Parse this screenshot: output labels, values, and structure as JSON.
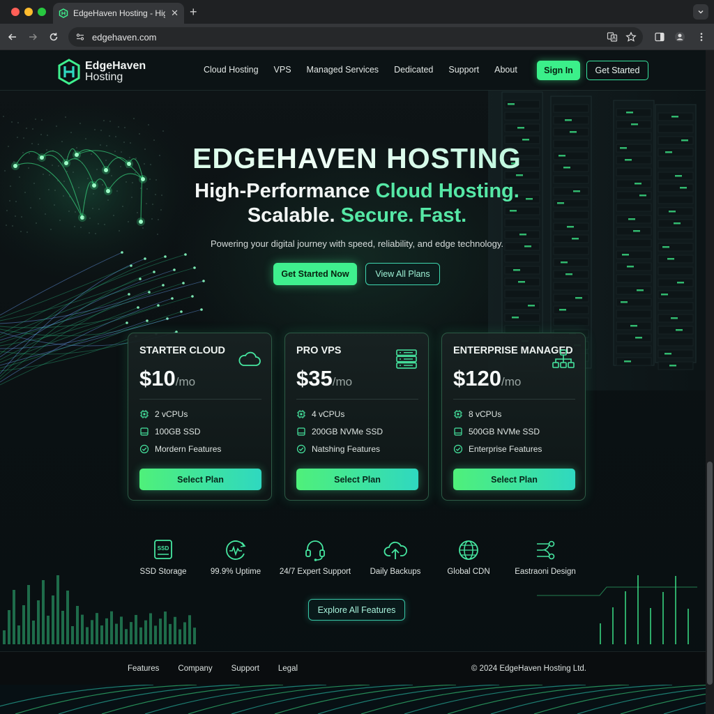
{
  "browser": {
    "tab_title": "EdgeHaven Hosting - High-Performance Cloud Hosting",
    "url": "edgehaven.com",
    "traffic_light_colors": [
      "#ff5f57",
      "#febc2e",
      "#28c840"
    ]
  },
  "header": {
    "logo_line1": "EdgeHaven",
    "logo_line2": "Hosting",
    "nav": [
      "Cloud Hosting",
      "VPS",
      "Managed Services",
      "Dedicated",
      "Support",
      "About"
    ],
    "sign_in": "Sign In",
    "get_started": "Get Started"
  },
  "hero": {
    "title": "EDGEHAVEN HOSTING",
    "sub1_plain": "High-Performance ",
    "sub1_accent": "Cloud Hosting.",
    "sub2_plain": "Scalable. ",
    "sub2_accent": "Secure. Fast.",
    "description": "Powering your digital journey with speed, reliability, and edge technology.",
    "cta_primary": "Get Started Now",
    "cta_secondary": "View All Plans"
  },
  "plans": [
    {
      "name": "STARTER CLOUD",
      "price": "$10",
      "period": "/mo",
      "icon": "cloud-icon",
      "features": [
        "2 vCPUs",
        "100GB SSD",
        "Mordern Features"
      ],
      "button": "Select Plan"
    },
    {
      "name": "PRO VPS",
      "price": "$35",
      "period": "/mo",
      "icon": "server-stack-icon",
      "features": [
        "4 vCPUs",
        "200GB NVMe SSD",
        "Natshing Features"
      ],
      "button": "Select Plan"
    },
    {
      "name": "ENTERPRISE MANAGED",
      "price": "$120",
      "period": "/mo",
      "icon": "network-hierarchy-icon",
      "features": [
        "8 vCPUs",
        "500GB NVMe SSD",
        "Enterprise Features"
      ],
      "button": "Select Plan"
    }
  ],
  "features": [
    {
      "label": "SSD Storage",
      "icon": "ssd-icon",
      "badge": "SSD"
    },
    {
      "label": "99.9% Uptime",
      "icon": "uptime-pulse-icon"
    },
    {
      "label": "24/7 Expert Support",
      "icon": "headset-icon"
    },
    {
      "label": "Daily Backups",
      "icon": "cloud-upload-icon"
    },
    {
      "label": "Global CDN",
      "icon": "globe-icon"
    },
    {
      "label": "Eastraoni Design",
      "icon": "design-nodes-icon"
    }
  ],
  "explore_button": "Explore All Features",
  "footer": {
    "links": [
      "Features",
      "Company",
      "Support",
      "Legal"
    ],
    "copyright": "© 2024 EdgeHaven Hosting Ltd."
  },
  "colors": {
    "accent": "#3ff08e",
    "accent_teal": "#38d8b0",
    "background": "#0b1113"
  }
}
